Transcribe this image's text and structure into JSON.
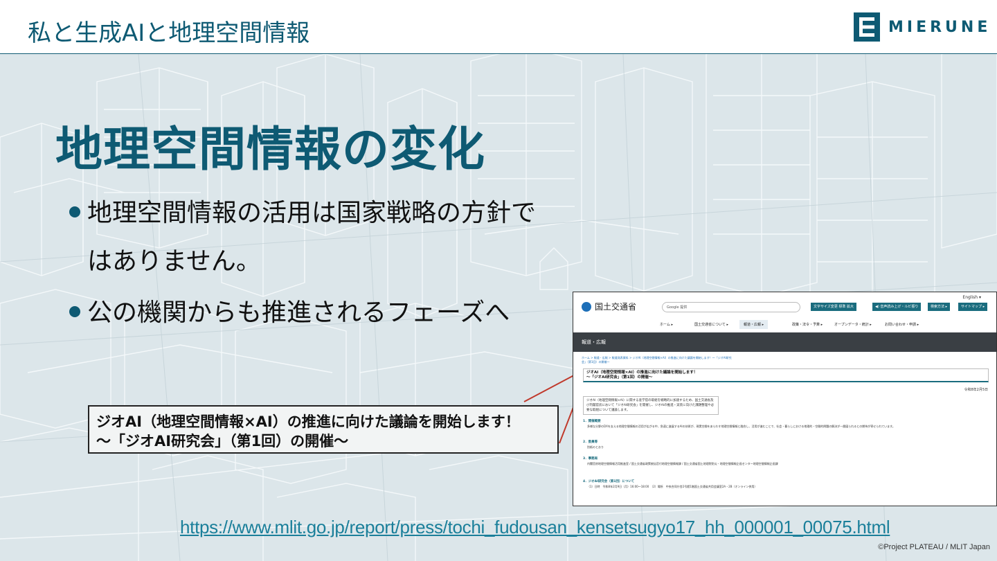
{
  "header": {
    "title": "私と生成AIと地理空間情報",
    "logo_text": "MIERUNE"
  },
  "slide": {
    "section_title": "地理空間情報の変化",
    "bullets": [
      "地理空間情報の活用は国家戦略の方針で",
      "はありません。",
      "公の機関からも推進されるフェーズへ"
    ],
    "callout": {
      "line1": "ジオAI（地理空間情報×AI）の推進に向けた議論を開始します！",
      "line2": "～「ジオAI研究会」（第1回）の開催～"
    },
    "url": "https://www.mlit.go.jp/report/press/tochi_fudousan_kensetsugyo17_hh_000001_00075.html",
    "credit": "©Project PLATEAU / MLIT Japan"
  },
  "screenshot": {
    "site_name": "国土交通省",
    "english": "English ▾",
    "search_placeholder": "Google 提供",
    "buttons": [
      "文字サイズ変更  標準  拡大",
      "◀) 音声読み上げ・ルビ振り",
      "検索方法 ▸",
      "サイトマップ ▸"
    ],
    "nav": [
      "ホーム ▸",
      "国土交通省について ▸",
      "報道・広報 ▸",
      "政策・法令・予算 ▸",
      "オープンデータ・統計 ▸",
      "お問い合わせ・申請 ▸"
    ],
    "band_title": "報道・広報",
    "breadcrumb": "ホーム > 報道・広報 > 報道発表資料 > ジオAI（地理空間情報×AI）の推進に向けた議論を開始します！～「ジオAI研究会」（第1回）の開催～",
    "headline1": "ジオAI（地理空間情報×AI）の推進に向けた議論を開始します！",
    "headline2": "～「ジオAI研究会」（第1回）の開催～",
    "date": "令和8年2月5日",
    "lead": "ジオAI（地理空間情報×AI）に関する産学官の取組を戦略的に加速するため、国土交通省及び内閣官房において「ジオAI研究会」を開催し、ジオAIの推進・実装に向けた課題整理や必要な取組について議論します。",
    "sections": [
      {
        "title": "1．開催概要",
        "body": "多様な分野のDXを支える地理空間情報の活用が広がる中、急速に進展するAIの技術が、現実空間をあらわす地理空間情報と融合し、活用が進むことで、社会・暮らしにおける地理的・空間的問題の解決が一層図られるとの期待が寄せられています。"
      },
      {
        "title": "2．委員等",
        "body": "別紙のとおり"
      },
      {
        "title": "3．事務局",
        "body": "内閣官房地理空間情報活用推進室 / 国土交通省政策統括官付地理空間情報課 / 国土交通省国土地理院防災・地理空間情報企画センター地理空間情報企画課"
      },
      {
        "title": "4．ジオAI研究会（第1回）について",
        "body": "（1）日時　令和8年2月9日（月）16:00～18:00　（2）場所　中央合同庁舎2号館1階国土交通省共用会議室2A・2B（オンライン併用）"
      }
    ]
  },
  "colors": {
    "brand": "#0e5a73",
    "link": "#1a7f9a",
    "button": "#1a6c7e"
  }
}
